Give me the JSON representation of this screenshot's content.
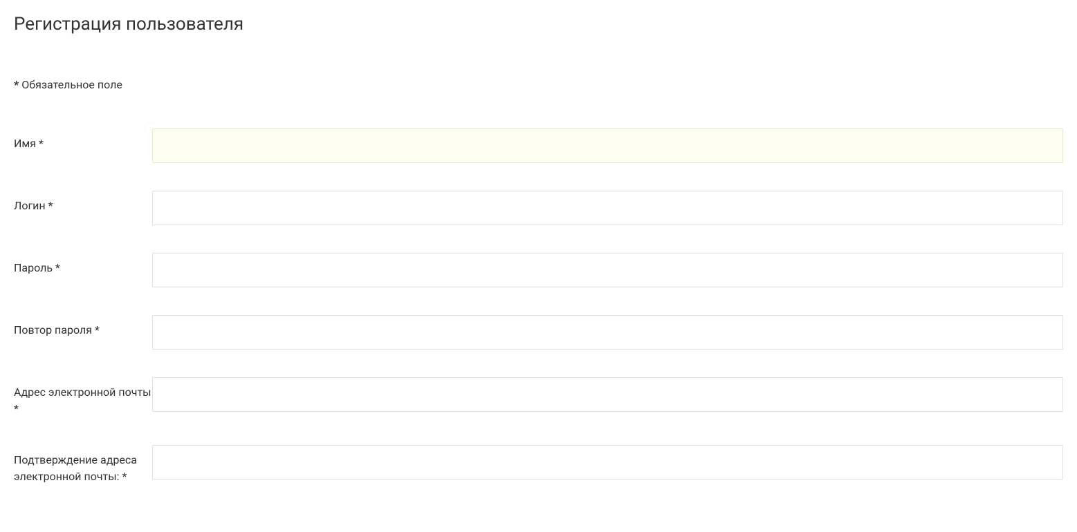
{
  "page": {
    "title": "Регистрация пользователя"
  },
  "required_note": {
    "asterisk": "*",
    "text": " Обязательное поле"
  },
  "fields": {
    "name": {
      "label": "Имя *",
      "value": ""
    },
    "login": {
      "label": "Логин *",
      "value": ""
    },
    "password": {
      "label": "Пароль *",
      "value": ""
    },
    "password_confirm": {
      "label": "Повтор пароля *",
      "value": ""
    },
    "email": {
      "label": "Адрес электронной почты *",
      "value": ""
    },
    "email_confirm": {
      "label": "Подтверждение адреса электронной почты: *",
      "value": ""
    }
  }
}
